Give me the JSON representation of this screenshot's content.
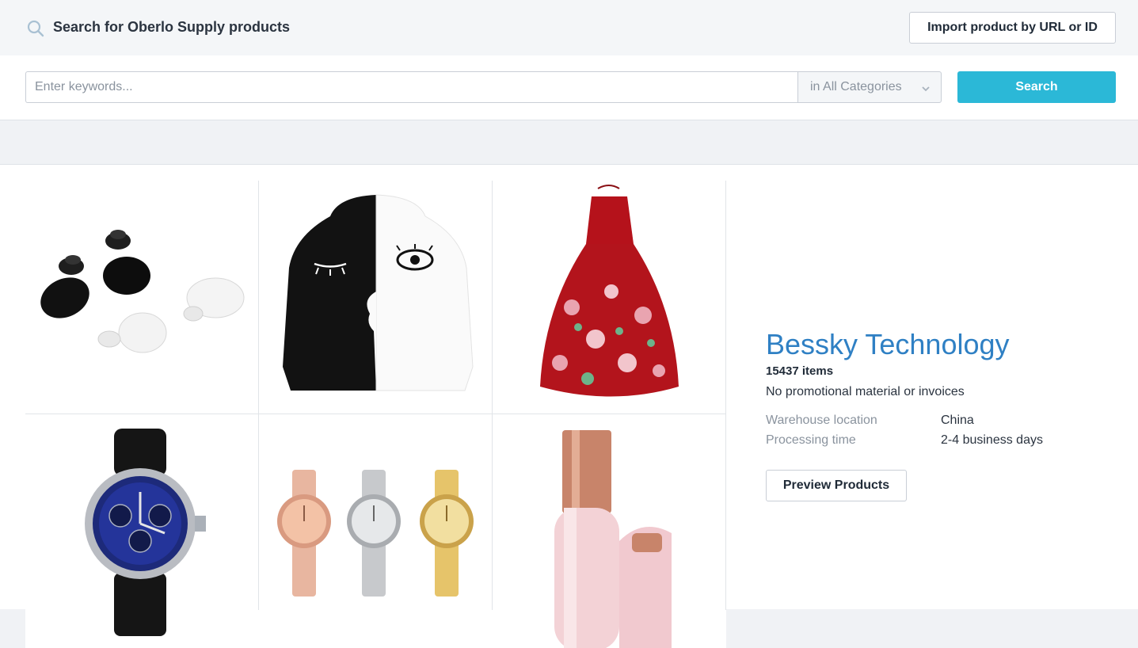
{
  "search": {
    "title": "Search for Oberlo Supply products",
    "import_label": "Import product by URL or ID",
    "keywords_placeholder": "Enter keywords...",
    "category_value": "in All Categories",
    "button_label": "Search"
  },
  "supplier": {
    "name": "Bessky Technology",
    "items_count": "15437 items",
    "promo_note": "No promotional material or invoices",
    "meta": [
      {
        "label": "Warehouse location",
        "value": "China"
      },
      {
        "label": "Processing time",
        "value": "2-4 business days"
      }
    ],
    "preview_label": "Preview Products"
  },
  "products": [
    {
      "icon": "earbuds-image"
    },
    {
      "icon": "hoodie-image"
    },
    {
      "icon": "dress-image"
    },
    {
      "icon": "wristwatch-image"
    },
    {
      "icon": "watches-set-image"
    },
    {
      "icon": "facial-trimmer-image"
    }
  ],
  "colors": {
    "accent": "#2bb8d7",
    "supplier_name": "#2f80c4"
  }
}
